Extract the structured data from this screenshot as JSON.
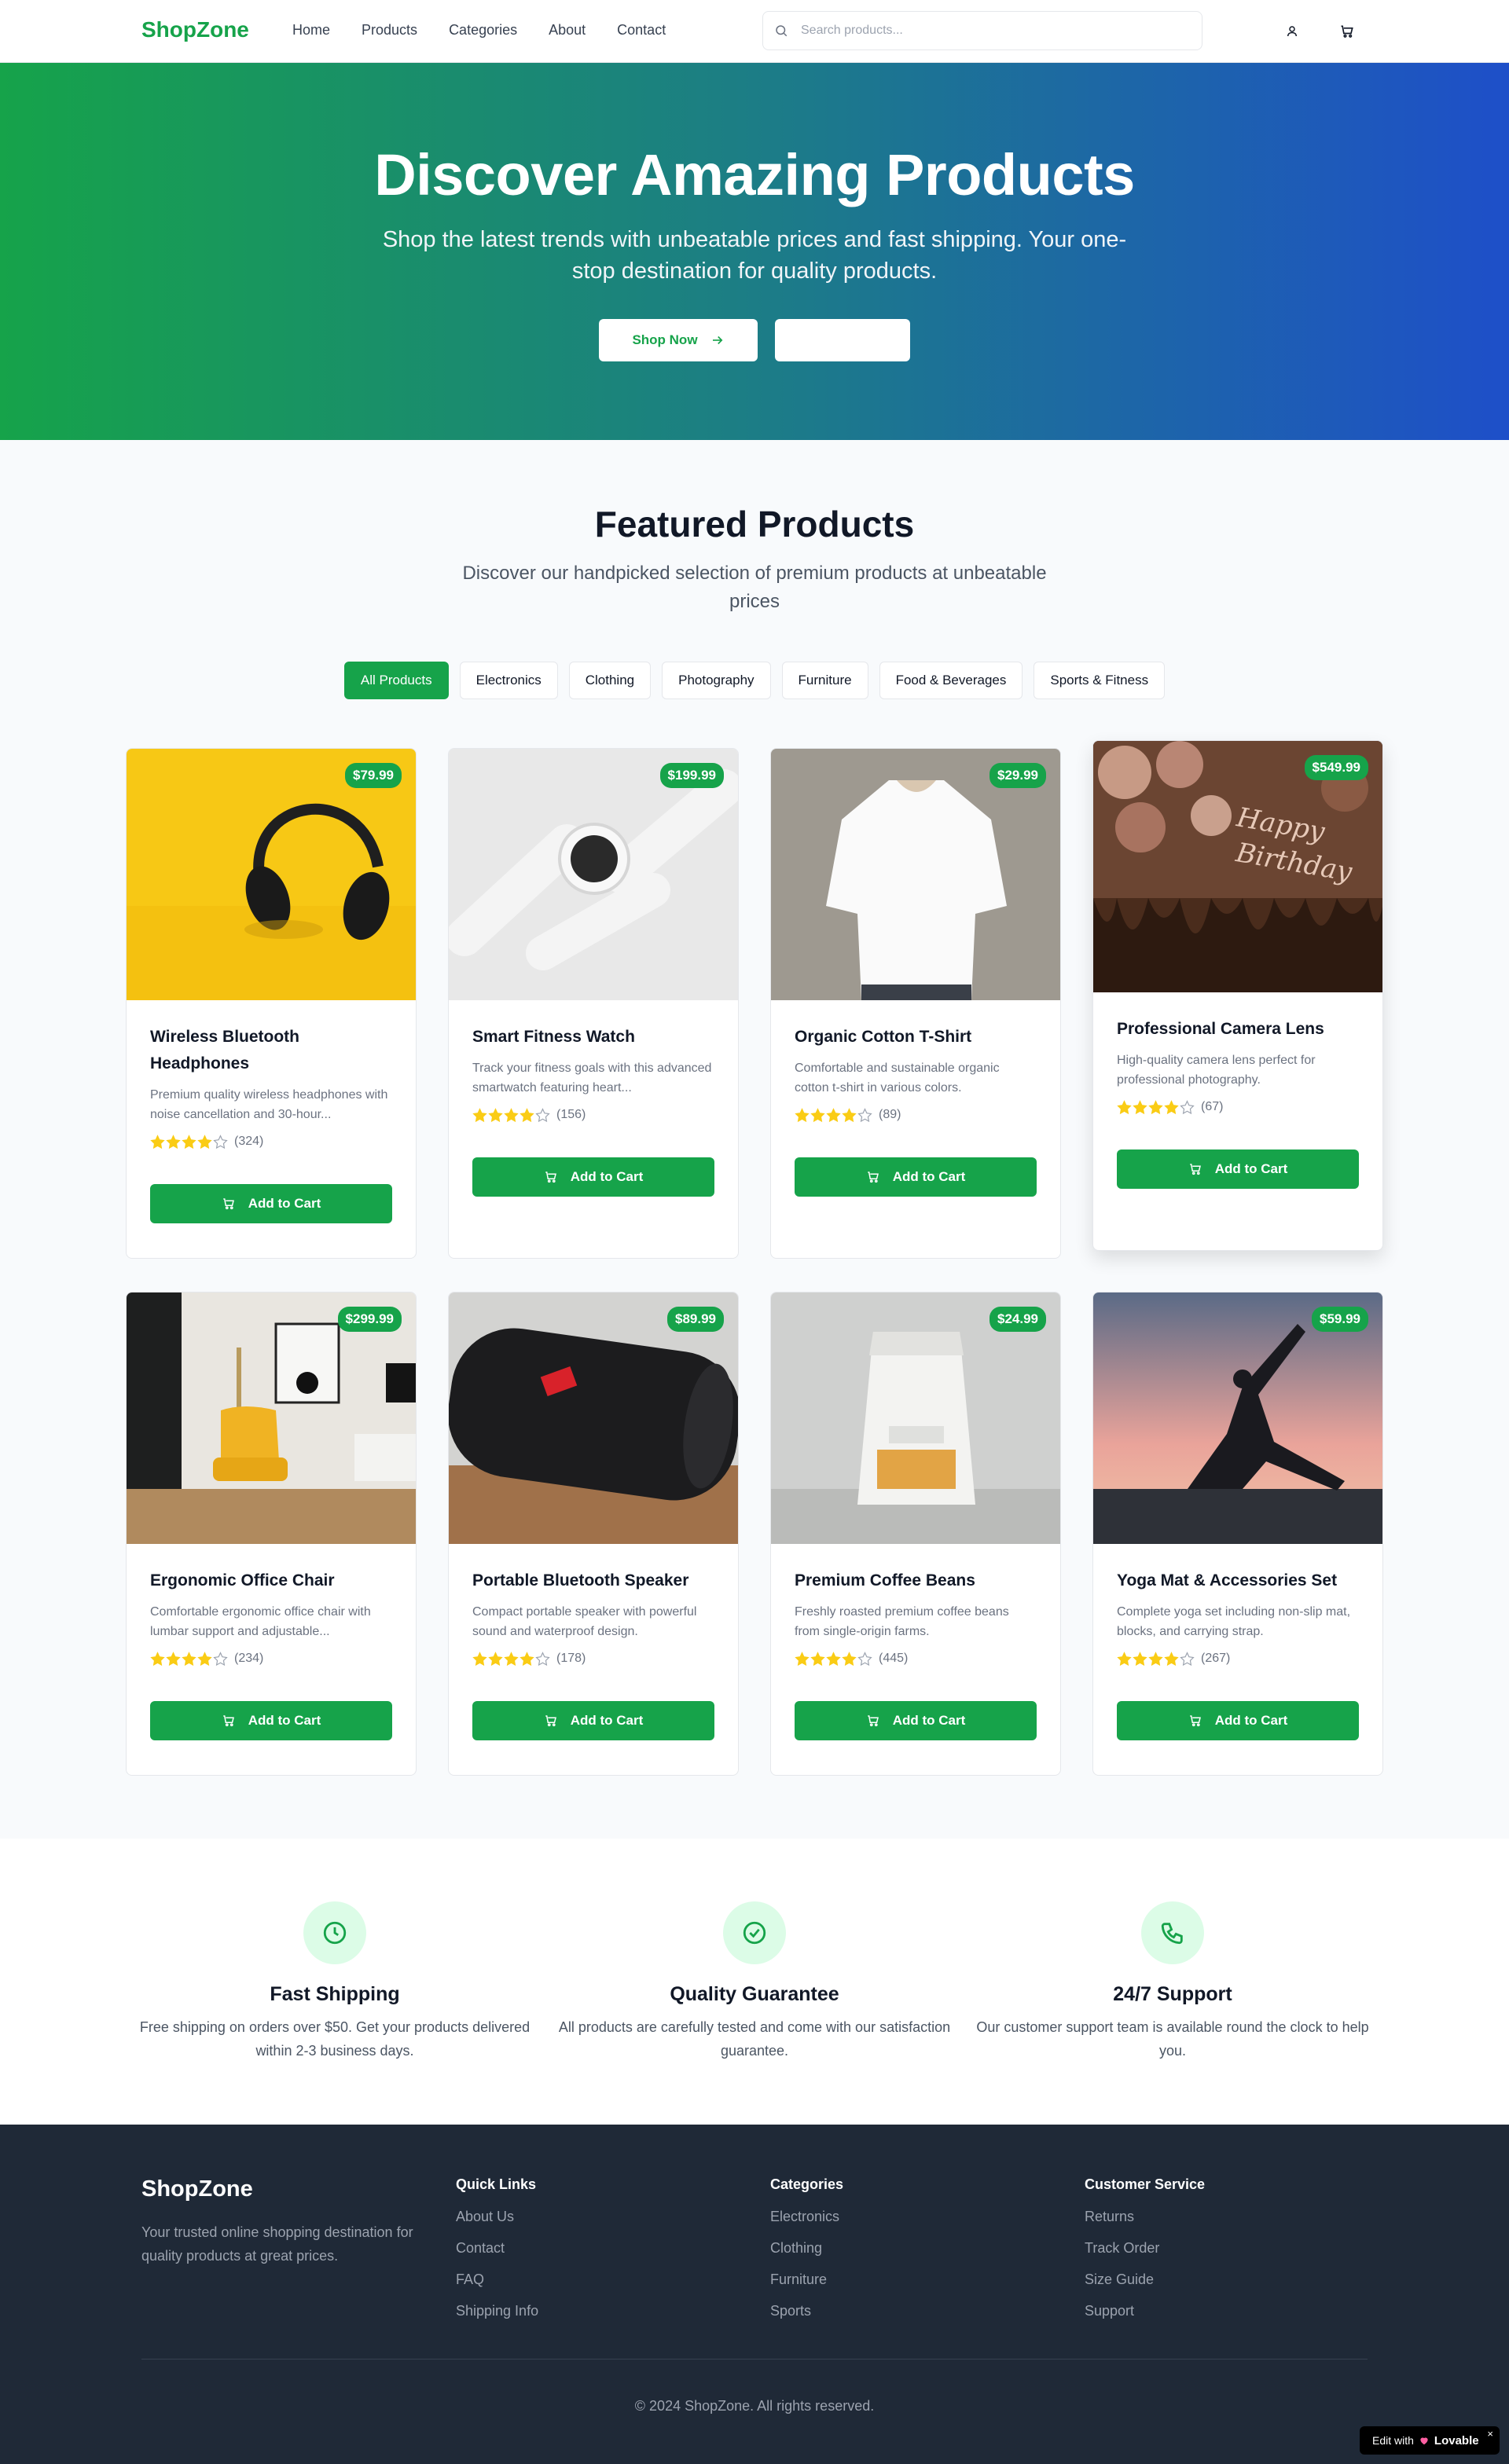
{
  "nav": {
    "brand": "ShopZone",
    "links": [
      "Home",
      "Products",
      "Categories",
      "About",
      "Contact"
    ],
    "search_placeholder": "Search products..."
  },
  "hero": {
    "title": "Discover Amazing Products",
    "subtitle": "Shop the latest trends with unbeatable prices and fast shipping. Your one-stop destination for quality products.",
    "primary_button": "Shop Now",
    "secondary_button": ""
  },
  "featured": {
    "title": "Featured Products",
    "subtitle": "Discover our handpicked selection of premium products at unbeatable prices",
    "filters": [
      "All Products",
      "Electronics",
      "Clothing",
      "Photography",
      "Furniture",
      "Food & Beverages",
      "Sports & Fitness"
    ],
    "active_filter": "All Products",
    "add_to_cart_label": "Add to Cart",
    "products": [
      {
        "name": "Wireless Bluetooth Headphones",
        "price": "$79.99",
        "description": "Premium quality wireless headphones with noise cancellation and 30-hour...",
        "rating": 4,
        "reviews": "(324)"
      },
      {
        "name": "Smart Fitness Watch",
        "price": "$199.99",
        "description": "Track your fitness goals with this advanced smartwatch featuring heart...",
        "rating": 4,
        "reviews": "(156)"
      },
      {
        "name": "Organic Cotton T-Shirt",
        "price": "$29.99",
        "description": "Comfortable and sustainable organic cotton t-shirt in various colors.",
        "rating": 4,
        "reviews": "(89)"
      },
      {
        "name": "Professional Camera Lens",
        "price": "$549.99",
        "description": "High-quality camera lens perfect for professional photography.",
        "rating": 4,
        "reviews": "(67)"
      },
      {
        "name": "Ergonomic Office Chair",
        "price": "$299.99",
        "description": "Comfortable ergonomic office chair with lumbar support and adjustable...",
        "rating": 4,
        "reviews": "(234)"
      },
      {
        "name": "Portable Bluetooth Speaker",
        "price": "$89.99",
        "description": "Compact portable speaker with powerful sound and waterproof design.",
        "rating": 4,
        "reviews": "(178)"
      },
      {
        "name": "Premium Coffee Beans",
        "price": "$24.99",
        "description": "Freshly roasted premium coffee beans from single-origin farms.",
        "rating": 4,
        "reviews": "(445)"
      },
      {
        "name": "Yoga Mat & Accessories Set",
        "price": "$59.99",
        "description": "Complete yoga set including non-slip mat, blocks, and carrying strap.",
        "rating": 4,
        "reviews": "(267)"
      }
    ]
  },
  "features": [
    {
      "icon": "clock-icon",
      "title": "Fast Shipping",
      "text": "Free shipping on orders over $50. Get your products delivered within 2-3 business days."
    },
    {
      "icon": "check-circle-icon",
      "title": "Quality Guarantee",
      "text": "All products are carefully tested and come with our satisfaction guarantee."
    },
    {
      "icon": "phone-icon",
      "title": "24/7 Support",
      "text": "Our customer support team is available round the clock to help you."
    }
  ],
  "footer": {
    "brand": "ShopZone",
    "tagline": "Your trusted online shopping destination for quality products at great prices.",
    "columns": [
      {
        "title": "Quick Links",
        "links": [
          "About Us",
          "Contact",
          "FAQ",
          "Shipping Info"
        ]
      },
      {
        "title": "Categories",
        "links": [
          "Electronics",
          "Clothing",
          "Furniture",
          "Sports"
        ]
      },
      {
        "title": "Customer Service",
        "links": [
          "Returns",
          "Track Order",
          "Size Guide",
          "Support"
        ]
      }
    ],
    "copyright": "© 2024 ShopZone. All rights reserved."
  },
  "badge": {
    "prefix": "Edit with",
    "name": "Lovable",
    "close": "×"
  },
  "colors": {
    "accent": "#16a34a",
    "hero_start": "#16a34a",
    "hero_end": "#1e4fc9",
    "footer_bg": "#1f2937",
    "star": "#facc15"
  }
}
